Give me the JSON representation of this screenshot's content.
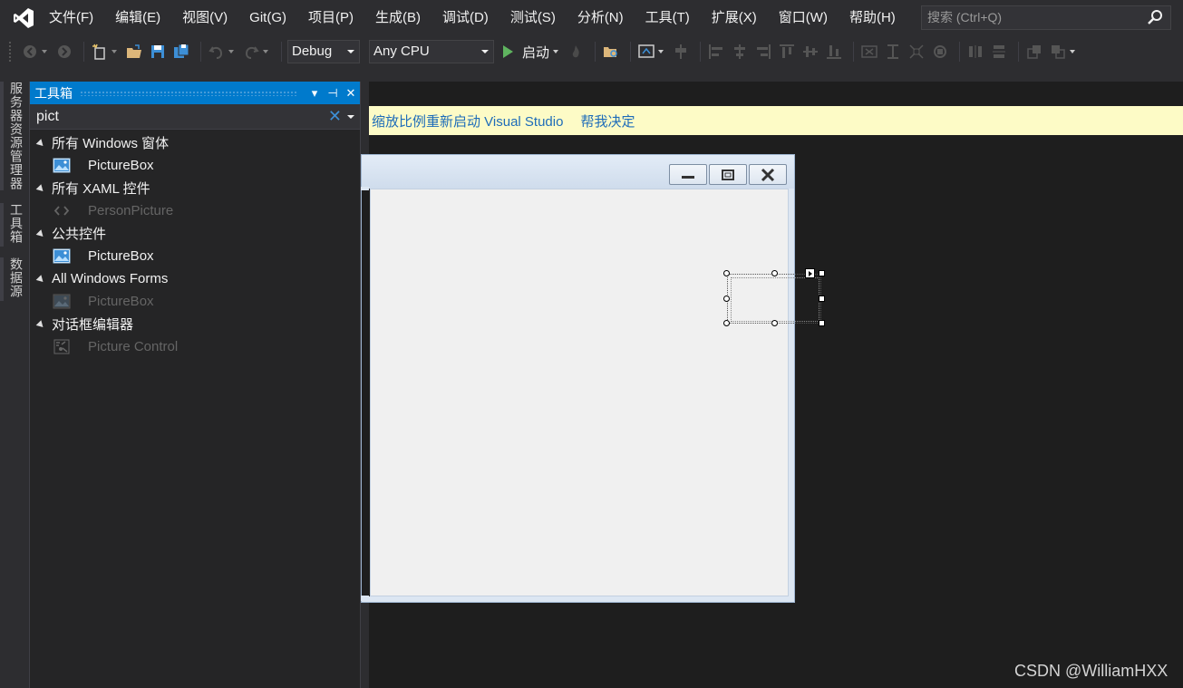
{
  "menu": {
    "items": [
      "文件(F)",
      "编辑(E)",
      "视图(V)",
      "Git(G)",
      "项目(P)",
      "生成(B)",
      "调试(D)",
      "测试(S)",
      "分析(N)",
      "工具(T)",
      "扩展(X)",
      "窗口(W)",
      "帮助(H)"
    ],
    "search_placeholder": "搜索 (Ctrl+Q)"
  },
  "toolbar": {
    "config": "Debug",
    "platform": "Any CPU",
    "start_label": "启动"
  },
  "rail": {
    "tabs": [
      "服务器资源管理器",
      "工具箱",
      "数据源"
    ]
  },
  "toolbox": {
    "title": "工具箱",
    "search_value": "pict",
    "groups": [
      {
        "label": "所有 Windows 窗体",
        "items": [
          {
            "label": "PictureBox",
            "disabled": false,
            "icon": "picture-icon"
          }
        ]
      },
      {
        "label": "所有 XAML 控件",
        "items": [
          {
            "label": "PersonPicture",
            "disabled": true,
            "icon": "code-brackets-icon"
          }
        ]
      },
      {
        "label": "公共控件",
        "items": [
          {
            "label": "PictureBox",
            "disabled": false,
            "icon": "picture-icon"
          }
        ]
      },
      {
        "label": "All Windows Forms",
        "items": [
          {
            "label": "PictureBox",
            "disabled": true,
            "icon": "picture-icon"
          }
        ]
      },
      {
        "label": "对话框编辑器",
        "items": [
          {
            "label": "Picture Control",
            "disabled": true,
            "icon": "picture-control-icon"
          }
        ]
      }
    ]
  },
  "infobar": {
    "message": "缩放比例重新启动 Visual Studio",
    "action": "帮我决定"
  },
  "watermark": "CSDN @WilliamHXX",
  "colors": {
    "accent": "#007acc",
    "menubar": "#2d2d30",
    "editor_bg": "#1e1e1e",
    "infobar_bg": "#fdfbc6",
    "link": "#1e6cb9"
  }
}
